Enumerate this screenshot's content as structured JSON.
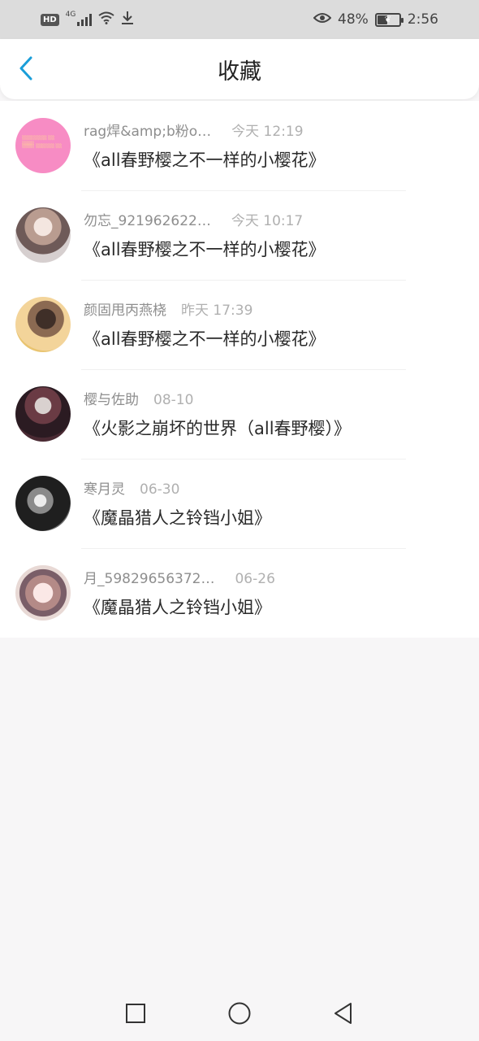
{
  "status_bar": {
    "hd": "HD",
    "network": "4G",
    "battery": "48%",
    "time": "2:56"
  },
  "header": {
    "title": "收藏",
    "accent_color": "#1a9ed9"
  },
  "favorites": [
    {
      "author": "rag焊&amp;b粉o…",
      "time": "今天 12:19",
      "title": "《all春野樱之不一样的小樱花》"
    },
    {
      "author": "勿忘_921962622…",
      "time": "今天 10:17",
      "title": "《all春野樱之不一样的小樱花》"
    },
    {
      "author": "颜固甩丙燕桡",
      "time": "昨天 17:39",
      "title": "《all春野樱之不一样的小樱花》"
    },
    {
      "author": "樱与佐助",
      "time": "08-10",
      "title": "《火影之崩坏的世界（all春野樱）》"
    },
    {
      "author": "寒月灵",
      "time": "06-30",
      "title": "《魔晶猎人之铃铛小姐》"
    },
    {
      "author": "月_59829656372…",
      "time": "06-26",
      "title": "《魔晶猎人之铃铛小姐》"
    }
  ],
  "icons": {
    "back": "chevron-left-icon",
    "recents": "square-icon",
    "home": "circle-icon",
    "nav_back": "triangle-back-icon"
  }
}
